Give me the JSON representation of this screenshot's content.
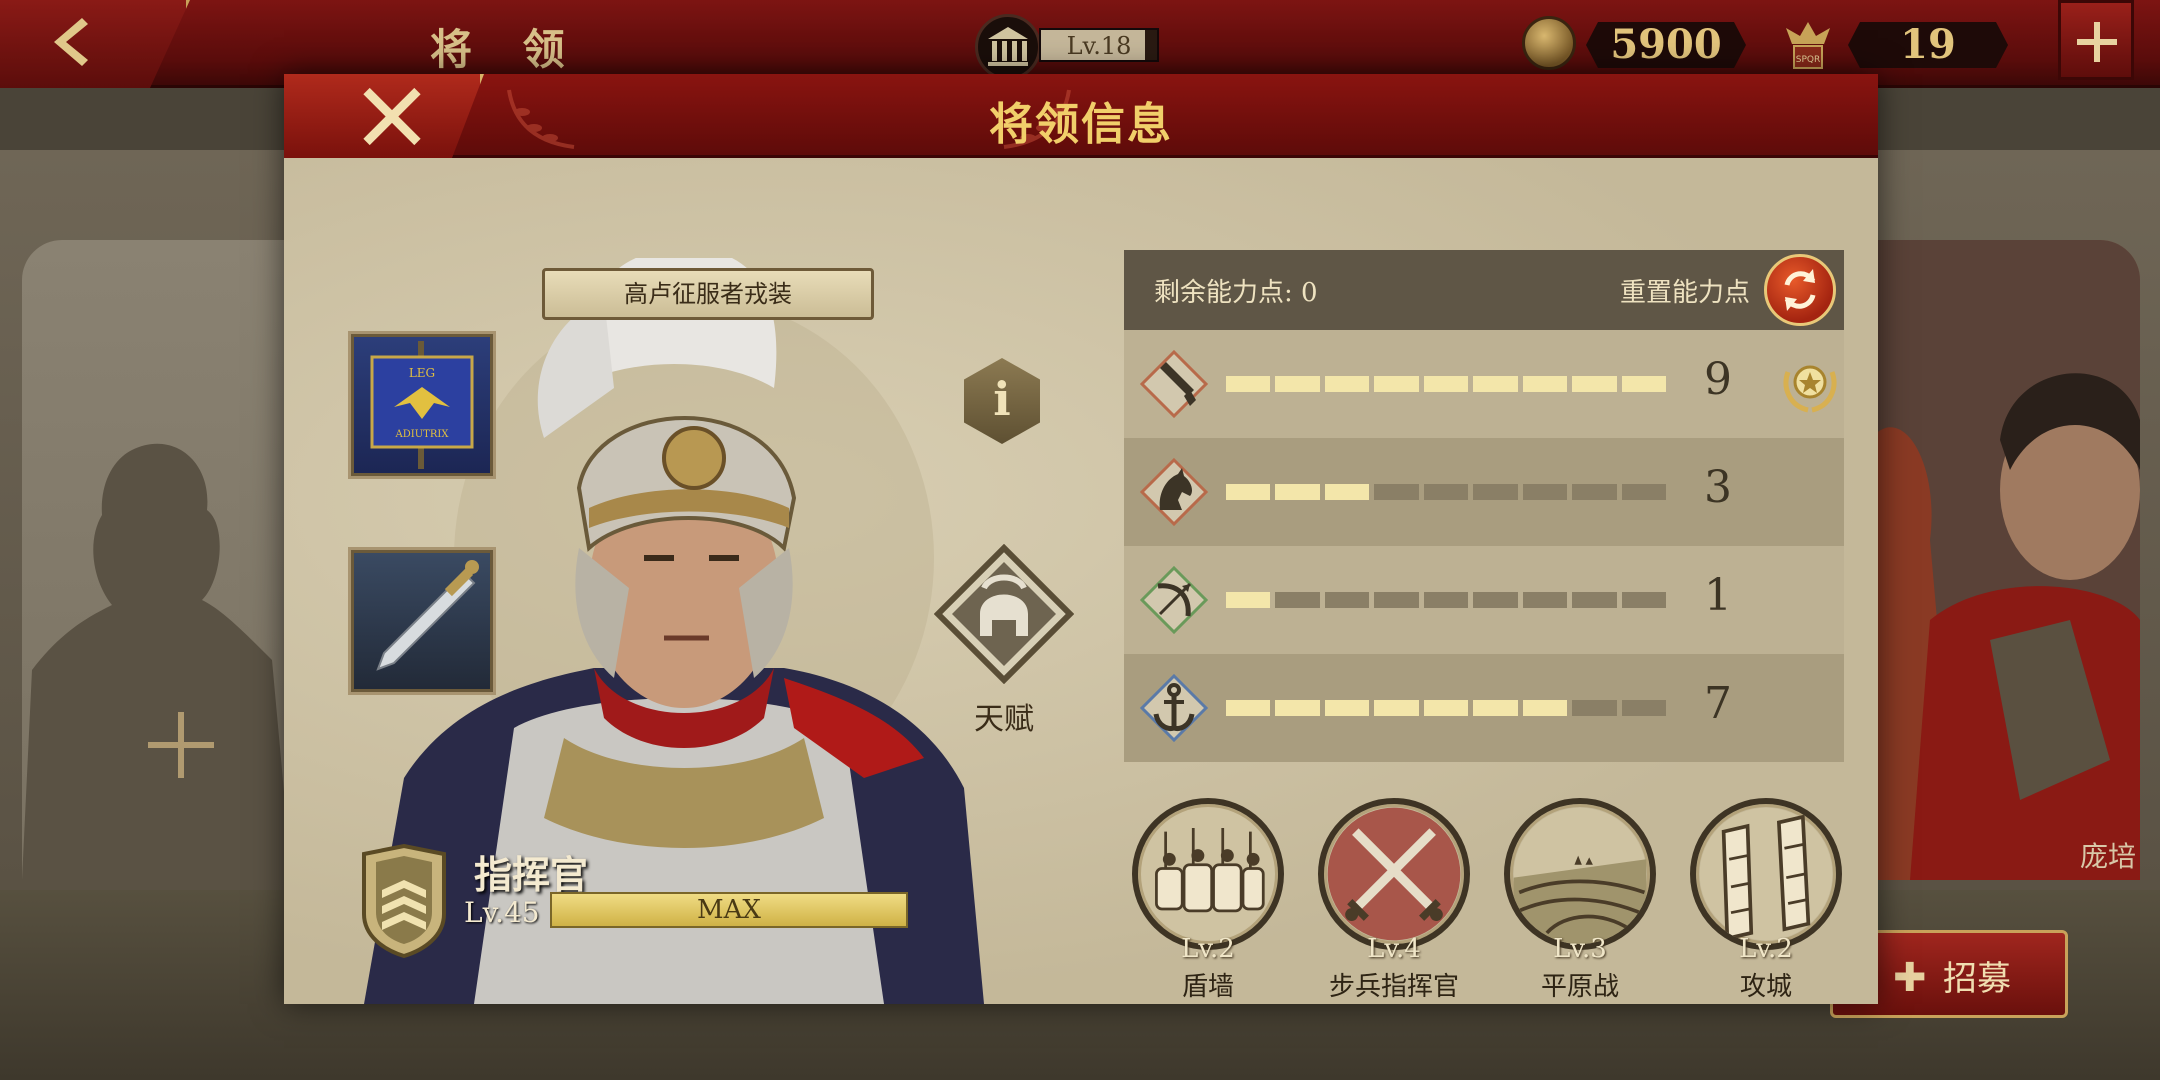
{
  "topbar": {
    "title": "将 领",
    "player_level": "Lv.18",
    "player_level_progress": 0.9,
    "coins": "5900",
    "tokens": "19"
  },
  "background": {
    "name_tag": "庞培",
    "recruit_label": "招募"
  },
  "modal": {
    "title": "将领信息",
    "outfit_name": "高卢征服者戎装",
    "talent_label": "天赋",
    "rank_name": "指挥官",
    "level": "Lv.45",
    "xp_label": "MAX",
    "remaining_points_label": "剩余能力点: 0",
    "reset_label": "重置能力点"
  },
  "stats": [
    {
      "icon": "sword-icon",
      "value": "9",
      "filled": 9,
      "max": 9,
      "award": true
    },
    {
      "icon": "horse-icon",
      "value": "3",
      "filled": 3,
      "max": 9,
      "award": false
    },
    {
      "icon": "bow-icon",
      "value": "1",
      "filled": 1,
      "max": 9,
      "award": false
    },
    {
      "icon": "anchor-icon",
      "value": "7",
      "filled": 7,
      "max": 9,
      "award": false
    }
  ],
  "skills": [
    {
      "level": "Lv.2",
      "name": "盾墙",
      "icon": "shield-wall-icon"
    },
    {
      "level": "Lv.4",
      "name": "步兵指挥官",
      "icon": "crossed-swords-icon"
    },
    {
      "level": "Lv.3",
      "name": "平原战",
      "icon": "plains-icon"
    },
    {
      "level": "Lv.2",
      "name": "攻城",
      "icon": "siege-wall-icon"
    }
  ]
}
